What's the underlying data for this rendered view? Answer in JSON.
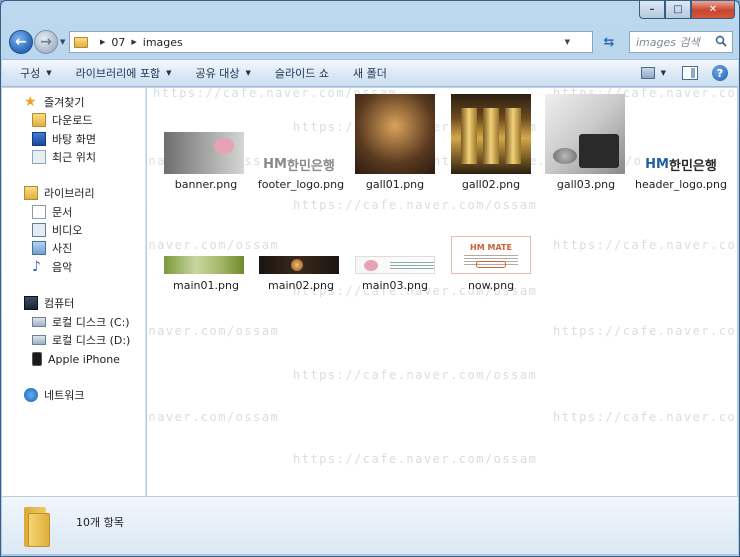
{
  "window": {
    "caption_min": "–",
    "caption_max": "□",
    "caption_close": "✕"
  },
  "address_bar": {
    "crumbs": [
      "07",
      "images"
    ],
    "search_placeholder": "images 검색"
  },
  "toolbar": {
    "organize": "구성",
    "include_in_library": "라이브러리에 포함",
    "share_with": "공유 대상",
    "slideshow": "슬라이드 쇼",
    "new_folder": "새 폴더"
  },
  "nav": {
    "favorites": {
      "label": "즐겨찾기",
      "items": [
        "다운로드",
        "바탕 화면",
        "최근 위치"
      ]
    },
    "libraries": {
      "label": "라이브러리",
      "items": [
        "문서",
        "비디오",
        "사진",
        "음악"
      ]
    },
    "computer": {
      "label": "컴퓨터",
      "items": [
        "로컬 디스크 (C:)",
        "로컬 디스크 (D:)",
        "Apple iPhone"
      ]
    },
    "network": {
      "label": "네트워크"
    }
  },
  "files": [
    {
      "name": "banner.png",
      "icon": "banner-thumbnail"
    },
    {
      "name": "footer_logo.png",
      "icon": "footer-logo-thumbnail",
      "logo_prefix": "HM",
      "logo_text": "한민은행"
    },
    {
      "name": "gall01.png",
      "icon": "gall01-thumbnail"
    },
    {
      "name": "gall02.png",
      "icon": "gall02-thumbnail"
    },
    {
      "name": "gall03.png",
      "icon": "gall03-thumbnail"
    },
    {
      "name": "header_logo.png",
      "icon": "header-logo-thumbnail",
      "logo_prefix": "HM",
      "logo_text": "한민은행"
    },
    {
      "name": "main01.png",
      "icon": "main01-thumbnail"
    },
    {
      "name": "main02.png",
      "icon": "main02-thumbnail"
    },
    {
      "name": "main03.png",
      "icon": "main03-thumbnail"
    },
    {
      "name": "now.png",
      "icon": "now-thumbnail",
      "thumb_title": "HM MATE"
    }
  ],
  "watermark_text": "https://cafe.naver.com/ossam",
  "status": {
    "item_count": "10개 항목"
  },
  "colors": {
    "accent": "#2a68b8",
    "selection": "#cce8ff",
    "window_frame": "#bcd8ef"
  }
}
